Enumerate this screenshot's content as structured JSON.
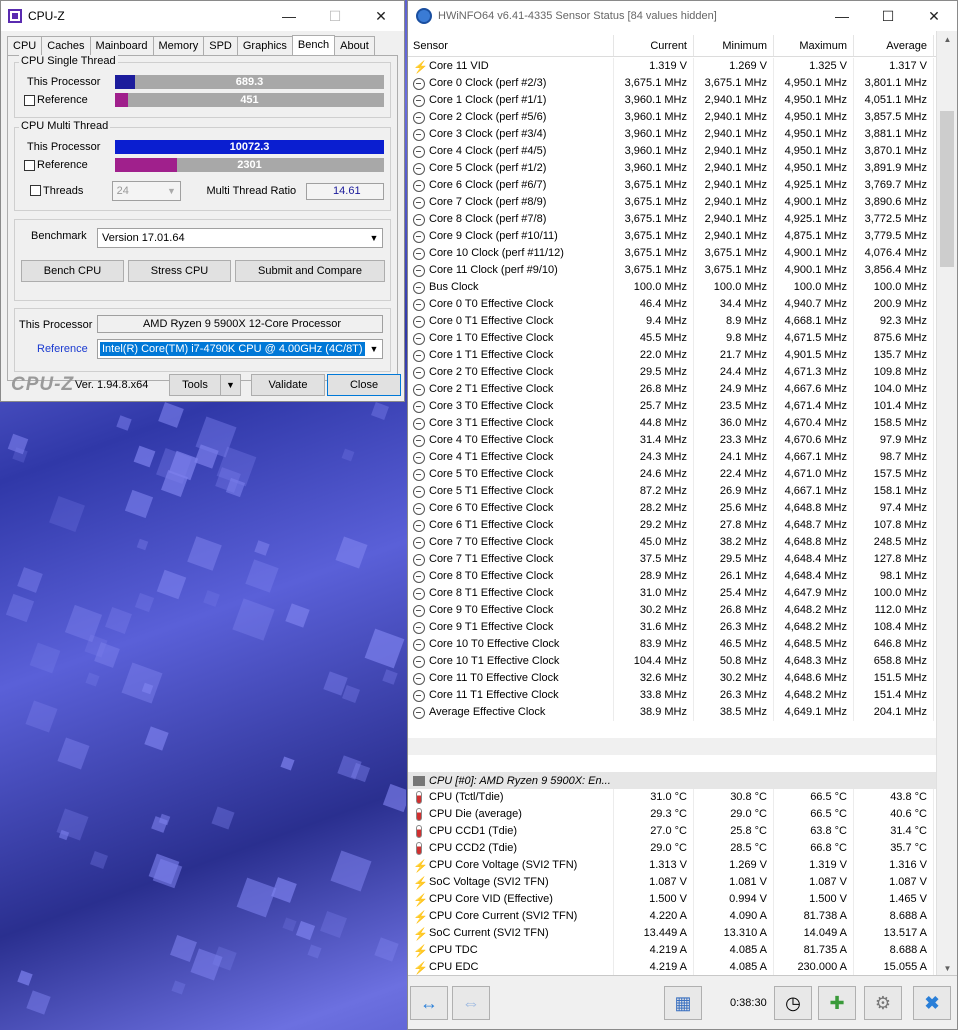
{
  "cpuz": {
    "title": "CPU-Z",
    "tabs": [
      "CPU",
      "Caches",
      "Mainboard",
      "Memory",
      "SPD",
      "Graphics",
      "Bench",
      "About"
    ],
    "active_tab": "Bench",
    "single": {
      "title": "CPU Single Thread",
      "this_label": "This Processor",
      "this_value": "689.3",
      "this_fraction": 0.074,
      "this_color": "#1c1c9c",
      "ref_label": "Reference",
      "ref_value": "451",
      "ref_fraction": 0.048,
      "ref_color": "#a0208c"
    },
    "multi": {
      "title": "CPU Multi Thread",
      "this_label": "This Processor",
      "this_value": "10072.3",
      "this_fraction": 1.0,
      "this_color": "#0a1ed0",
      "ref_label": "Reference",
      "ref_value": "2301",
      "ref_fraction": 0.23,
      "ref_color": "#a0208c",
      "threads_label": "Threads",
      "threads_value": "24",
      "ratio_label": "Multi Thread Ratio",
      "ratio_value": "14.61"
    },
    "benchmark_label": "Benchmark",
    "benchmark_version": "Version 17.01.64",
    "buttons": {
      "bench": "Bench CPU",
      "stress": "Stress CPU",
      "submit": "Submit and Compare"
    },
    "this_processor_label": "This Processor",
    "this_processor_value": "AMD Ryzen 9 5900X 12-Core Processor",
    "reference_label": "Reference",
    "reference_value": "Intel(R) Core(TM) i7-4790K CPU @ 4.00GHz (4C/8T)",
    "logo": "CPU-Z",
    "version": "Ver. 1.94.8.x64",
    "tools": "Tools",
    "validate": "Validate",
    "close": "Close"
  },
  "hwinfo": {
    "title": "HWiNFO64 v6.41-4335 Sensor Status [84 values hidden]",
    "columns": [
      "Sensor",
      "Current",
      "Minimum",
      "Maximum",
      "Average"
    ],
    "rows": [
      {
        "icon": "bolt",
        "name": "Core 11 VID",
        "cur": "1.319 V",
        "min": "1.269 V",
        "max": "1.325 V",
        "avg": "1.317 V"
      },
      {
        "icon": "clock",
        "name": "Core 0 Clock (perf #2/3)",
        "cur": "3,675.1 MHz",
        "min": "3,675.1 MHz",
        "max": "4,950.1 MHz",
        "avg": "3,801.1 MHz"
      },
      {
        "icon": "clock",
        "name": "Core 1 Clock (perf #1/1)",
        "cur": "3,960.1 MHz",
        "min": "2,940.1 MHz",
        "max": "4,950.1 MHz",
        "avg": "4,051.1 MHz"
      },
      {
        "icon": "clock",
        "name": "Core 2 Clock (perf #5/6)",
        "cur": "3,960.1 MHz",
        "min": "2,940.1 MHz",
        "max": "4,950.1 MHz",
        "avg": "3,857.5 MHz"
      },
      {
        "icon": "clock",
        "name": "Core 3 Clock (perf #3/4)",
        "cur": "3,960.1 MHz",
        "min": "2,940.1 MHz",
        "max": "4,950.1 MHz",
        "avg": "3,881.1 MHz"
      },
      {
        "icon": "clock",
        "name": "Core 4 Clock (perf #4/5)",
        "cur": "3,960.1 MHz",
        "min": "2,940.1 MHz",
        "max": "4,950.1 MHz",
        "avg": "3,870.1 MHz"
      },
      {
        "icon": "clock",
        "name": "Core 5 Clock (perf #1/2)",
        "cur": "3,960.1 MHz",
        "min": "2,940.1 MHz",
        "max": "4,950.1 MHz",
        "avg": "3,891.9 MHz"
      },
      {
        "icon": "clock",
        "name": "Core 6 Clock (perf #6/7)",
        "cur": "3,675.1 MHz",
        "min": "2,940.1 MHz",
        "max": "4,925.1 MHz",
        "avg": "3,769.7 MHz"
      },
      {
        "icon": "clock",
        "name": "Core 7 Clock (perf #8/9)",
        "cur": "3,675.1 MHz",
        "min": "2,940.1 MHz",
        "max": "4,900.1 MHz",
        "avg": "3,890.6 MHz"
      },
      {
        "icon": "clock",
        "name": "Core 8 Clock (perf #7/8)",
        "cur": "3,675.1 MHz",
        "min": "2,940.1 MHz",
        "max": "4,925.1 MHz",
        "avg": "3,772.5 MHz"
      },
      {
        "icon": "clock",
        "name": "Core 9 Clock (perf #10/11)",
        "cur": "3,675.1 MHz",
        "min": "2,940.1 MHz",
        "max": "4,875.1 MHz",
        "avg": "3,779.5 MHz"
      },
      {
        "icon": "clock",
        "name": "Core 10 Clock (perf #11/12)",
        "cur": "3,675.1 MHz",
        "min": "3,675.1 MHz",
        "max": "4,900.1 MHz",
        "avg": "4,076.4 MHz"
      },
      {
        "icon": "clock",
        "name": "Core 11 Clock (perf #9/10)",
        "cur": "3,675.1 MHz",
        "min": "3,675.1 MHz",
        "max": "4,900.1 MHz",
        "avg": "3,856.4 MHz"
      },
      {
        "icon": "clock",
        "name": "Bus Clock",
        "cur": "100.0 MHz",
        "min": "100.0 MHz",
        "max": "100.0 MHz",
        "avg": "100.0 MHz"
      },
      {
        "icon": "clock",
        "name": "Core 0 T0 Effective Clock",
        "cur": "46.4 MHz",
        "min": "34.4 MHz",
        "max": "4,940.7 MHz",
        "avg": "200.9 MHz"
      },
      {
        "icon": "clock",
        "name": "Core 0 T1 Effective Clock",
        "cur": "9.4 MHz",
        "min": "8.9 MHz",
        "max": "4,668.1 MHz",
        "avg": "92.3 MHz"
      },
      {
        "icon": "clock",
        "name": "Core 1 T0 Effective Clock",
        "cur": "45.5 MHz",
        "min": "9.8 MHz",
        "max": "4,671.5 MHz",
        "avg": "875.6 MHz"
      },
      {
        "icon": "clock",
        "name": "Core 1 T1 Effective Clock",
        "cur": "22.0 MHz",
        "min": "21.7 MHz",
        "max": "4,901.5 MHz",
        "avg": "135.7 MHz"
      },
      {
        "icon": "clock",
        "name": "Core 2 T0 Effective Clock",
        "cur": "29.5 MHz",
        "min": "24.4 MHz",
        "max": "4,671.3 MHz",
        "avg": "109.8 MHz"
      },
      {
        "icon": "clock",
        "name": "Core 2 T1 Effective Clock",
        "cur": "26.8 MHz",
        "min": "24.9 MHz",
        "max": "4,667.6 MHz",
        "avg": "104.0 MHz"
      },
      {
        "icon": "clock",
        "name": "Core 3 T0 Effective Clock",
        "cur": "25.7 MHz",
        "min": "23.5 MHz",
        "max": "4,671.4 MHz",
        "avg": "101.4 MHz"
      },
      {
        "icon": "clock",
        "name": "Core 3 T1 Effective Clock",
        "cur": "44.8 MHz",
        "min": "36.0 MHz",
        "max": "4,670.4 MHz",
        "avg": "158.5 MHz"
      },
      {
        "icon": "clock",
        "name": "Core 4 T0 Effective Clock",
        "cur": "31.4 MHz",
        "min": "23.3 MHz",
        "max": "4,670.6 MHz",
        "avg": "97.9 MHz"
      },
      {
        "icon": "clock",
        "name": "Core 4 T1 Effective Clock",
        "cur": "24.3 MHz",
        "min": "24.1 MHz",
        "max": "4,667.1 MHz",
        "avg": "98.7 MHz"
      },
      {
        "icon": "clock",
        "name": "Core 5 T0 Effective Clock",
        "cur": "24.6 MHz",
        "min": "22.4 MHz",
        "max": "4,671.0 MHz",
        "avg": "157.5 MHz"
      },
      {
        "icon": "clock",
        "name": "Core 5 T1 Effective Clock",
        "cur": "87.2 MHz",
        "min": "26.9 MHz",
        "max": "4,667.1 MHz",
        "avg": "158.1 MHz"
      },
      {
        "icon": "clock",
        "name": "Core 6 T0 Effective Clock",
        "cur": "28.2 MHz",
        "min": "25.6 MHz",
        "max": "4,648.8 MHz",
        "avg": "97.4 MHz"
      },
      {
        "icon": "clock",
        "name": "Core 6 T1 Effective Clock",
        "cur": "29.2 MHz",
        "min": "27.8 MHz",
        "max": "4,648.7 MHz",
        "avg": "107.8 MHz"
      },
      {
        "icon": "clock",
        "name": "Core 7 T0 Effective Clock",
        "cur": "45.0 MHz",
        "min": "38.2 MHz",
        "max": "4,648.8 MHz",
        "avg": "248.5 MHz"
      },
      {
        "icon": "clock",
        "name": "Core 7 T1 Effective Clock",
        "cur": "37.5 MHz",
        "min": "29.5 MHz",
        "max": "4,648.4 MHz",
        "avg": "127.8 MHz"
      },
      {
        "icon": "clock",
        "name": "Core 8 T0 Effective Clock",
        "cur": "28.9 MHz",
        "min": "26.1 MHz",
        "max": "4,648.4 MHz",
        "avg": "98.1 MHz"
      },
      {
        "icon": "clock",
        "name": "Core 8 T1 Effective Clock",
        "cur": "31.0 MHz",
        "min": "25.4 MHz",
        "max": "4,647.9 MHz",
        "avg": "100.0 MHz"
      },
      {
        "icon": "clock",
        "name": "Core 9 T0 Effective Clock",
        "cur": "30.2 MHz",
        "min": "26.8 MHz",
        "max": "4,648.2 MHz",
        "avg": "112.0 MHz"
      },
      {
        "icon": "clock",
        "name": "Core 9 T1 Effective Clock",
        "cur": "31.6 MHz",
        "min": "26.3 MHz",
        "max": "4,648.2 MHz",
        "avg": "108.4 MHz"
      },
      {
        "icon": "clock",
        "name": "Core 10 T0 Effective Clock",
        "cur": "83.9 MHz",
        "min": "46.5 MHz",
        "max": "4,648.5 MHz",
        "avg": "646.8 MHz"
      },
      {
        "icon": "clock",
        "name": "Core 10 T1 Effective Clock",
        "cur": "104.4 MHz",
        "min": "50.8 MHz",
        "max": "4,648.3 MHz",
        "avg": "658.8 MHz"
      },
      {
        "icon": "clock",
        "name": "Core 11 T0 Effective Clock",
        "cur": "32.6 MHz",
        "min": "30.2 MHz",
        "max": "4,648.6 MHz",
        "avg": "151.5 MHz"
      },
      {
        "icon": "clock",
        "name": "Core 11 T1 Effective Clock",
        "cur": "33.8 MHz",
        "min": "26.3 MHz",
        "max": "4,648.2 MHz",
        "avg": "151.4 MHz"
      },
      {
        "icon": "clock",
        "name": "Average Effective Clock",
        "cur": "38.9 MHz",
        "min": "38.5 MHz",
        "max": "4,649.1 MHz",
        "avg": "204.1 MHz"
      }
    ],
    "group_title": "CPU [#0]: AMD Ryzen 9 5900X: En...",
    "rows2": [
      {
        "icon": "therm",
        "name": "CPU (Tctl/Tdie)",
        "cur": "31.0 °C",
        "min": "30.8 °C",
        "max": "66.5 °C",
        "avg": "43.8 °C"
      },
      {
        "icon": "therm",
        "name": "CPU Die (average)",
        "cur": "29.3 °C",
        "min": "29.0 °C",
        "max": "66.5 °C",
        "avg": "40.6 °C"
      },
      {
        "icon": "therm",
        "name": "CPU CCD1 (Tdie)",
        "cur": "27.0 °C",
        "min": "25.8 °C",
        "max": "63.8 °C",
        "avg": "31.4 °C"
      },
      {
        "icon": "therm",
        "name": "CPU CCD2 (Tdie)",
        "cur": "29.0 °C",
        "min": "28.5 °C",
        "max": "66.8 °C",
        "avg": "35.7 °C"
      },
      {
        "icon": "bolt",
        "name": "CPU Core Voltage (SVI2 TFN)",
        "cur": "1.313 V",
        "min": "1.269 V",
        "max": "1.319 V",
        "avg": "1.316 V"
      },
      {
        "icon": "bolt",
        "name": "SoC Voltage (SVI2 TFN)",
        "cur": "1.087 V",
        "min": "1.081 V",
        "max": "1.087 V",
        "avg": "1.087 V"
      },
      {
        "icon": "bolt",
        "name": "CPU Core VID (Effective)",
        "cur": "1.500 V",
        "min": "0.994 V",
        "max": "1.500 V",
        "avg": "1.465 V"
      },
      {
        "icon": "bolt",
        "name": "CPU Core Current (SVI2 TFN)",
        "cur": "4.220 A",
        "min": "4.090 A",
        "max": "81.738 A",
        "avg": "8.688 A"
      },
      {
        "icon": "bolt",
        "name": "SoC Current (SVI2 TFN)",
        "cur": "13.449 A",
        "min": "13.310 A",
        "max": "14.049 A",
        "avg": "13.517 A"
      },
      {
        "icon": "bolt",
        "name": "CPU TDC",
        "cur": "4.219 A",
        "min": "4.085 A",
        "max": "81.735 A",
        "avg": "8.688 A"
      },
      {
        "icon": "bolt",
        "name": "CPU EDC",
        "cur": "4.219 A",
        "min": "4.085 A",
        "max": "230.000 A",
        "avg": "15.055 A"
      }
    ],
    "timer": "0:38:30"
  }
}
